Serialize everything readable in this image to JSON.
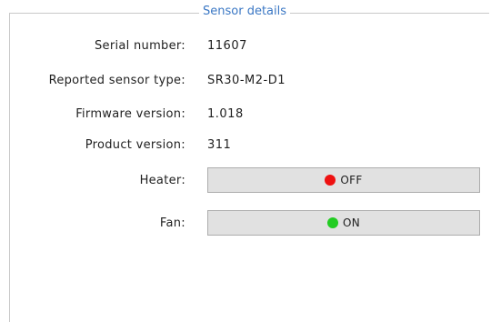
{
  "panel": {
    "title": "Sensor details"
  },
  "fields": [
    {
      "label": "Serial number:",
      "value": "11607"
    },
    {
      "label": "Reported sensor type:",
      "value": "SR30-M2-D1"
    },
    {
      "label": "Firmware version:",
      "value": "1.018"
    },
    {
      "label": "Product version:",
      "value": "311"
    }
  ],
  "heater": {
    "label": "Heater:",
    "state": "OFF",
    "indicator_color": "#ee1111",
    "indicator_icon": "status-dot-red"
  },
  "fan": {
    "label": "Fan:",
    "state": "ON",
    "indicator_color": "#22cc22",
    "indicator_icon": "status-dot-green"
  }
}
